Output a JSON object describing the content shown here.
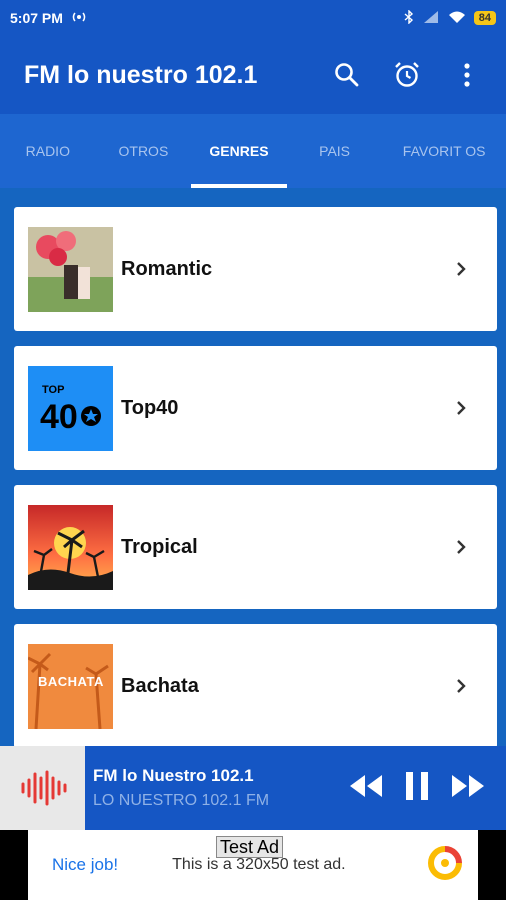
{
  "status": {
    "time": "5:07 PM",
    "battery": "84"
  },
  "app": {
    "title": "FM lo nuestro 102.1"
  },
  "tabs": [
    {
      "label": "RADIO"
    },
    {
      "label": "OTROS"
    },
    {
      "label": "GENRES"
    },
    {
      "label": "PAIS"
    },
    {
      "label": "FAVORIT OS"
    }
  ],
  "genres": [
    {
      "label": "Romantic"
    },
    {
      "label": "Top40",
      "thumb_text": "TOP"
    },
    {
      "label": "Tropical"
    },
    {
      "label": "Bachata",
      "thumb_text": "BACHATA"
    }
  ],
  "player": {
    "title": "FM lo Nuestro 102.1",
    "subtitle": "LO NUESTRO 102.1 FM"
  },
  "ad": {
    "label": "Test Ad",
    "nice": "Nice job!",
    "text": "This is a 320x50 test ad."
  },
  "colors": {
    "primary": "#1556c4",
    "tabs": "#1e66d0",
    "accent_red": "#e53935"
  }
}
